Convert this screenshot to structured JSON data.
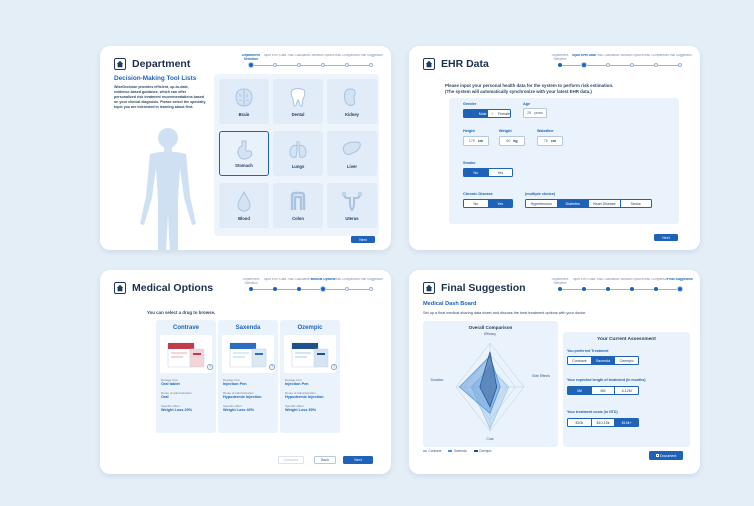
{
  "department": {
    "title": "Department",
    "subtitle": "Decision-Making Tool Lists",
    "description": "WiseDecision provides efficient, up-to-date, evidence-based guidance, which can offer personalized risk treatment recommendations based on your clinical diagnosis. Please select the specialty topic you are interested in learning about first.",
    "organs": [
      {
        "label": "Brain",
        "icon": "brain-icon"
      },
      {
        "label": "Dental",
        "icon": "tooth-icon"
      },
      {
        "label": "Kidney",
        "icon": "kidney-icon"
      },
      {
        "label": "Stomach",
        "icon": "stomach-icon"
      },
      {
        "label": "Lungs",
        "icon": "lungs-icon"
      },
      {
        "label": "Liver",
        "icon": "liver-icon"
      },
      {
        "label": "Blood",
        "icon": "blood-drop-icon"
      },
      {
        "label": "Colon",
        "icon": "colon-icon"
      },
      {
        "label": "Uterus",
        "icon": "uterus-icon"
      }
    ],
    "selected_organ": "Stomach",
    "next_label": "Next",
    "active_step": 0
  },
  "steps": [
    {
      "label": "Department Selection"
    },
    {
      "label": "Input EHR Data"
    },
    {
      "label": "Risk Calculation"
    },
    {
      "label": "Medical Options"
    },
    {
      "label": "Risk Comparison"
    },
    {
      "label": "Final Suggestion"
    }
  ],
  "ehr": {
    "title": "EHR Data",
    "intro_line1": "Please input your personal health data for the system to perform risk estimation.",
    "intro_line2": "(The system will automatically synchronize with your latest EHR data.)",
    "gender_label": "Gender",
    "male_label": "Male",
    "female_label": "Female",
    "age_label": "Age",
    "age_value": "25",
    "age_unit": "years",
    "height_label": "Height",
    "height_value": "170",
    "height_unit": "cm",
    "weight_label": "Weight",
    "weight_value": "60",
    "weight_unit": "kg",
    "waistline_label": "Waistline",
    "waistline_value": "70",
    "waistline_unit": "cm",
    "smoke_label": "Smoke",
    "no_label": "No",
    "yes_label": "Yes",
    "chronic_label": "Chronic Disease",
    "multi_label": "(multiple choice)",
    "diseases": [
      "Hypertension",
      "Diabetes",
      "Heart Disease",
      "Stroke"
    ],
    "next_label": "Next",
    "active_step": 1
  },
  "medical": {
    "title": "Medical Options",
    "hint": "You can select a drug to browse.",
    "dosage_key": "Dosage form",
    "route_key": "Route of administration",
    "effect_key": "Specific effect",
    "drugs": [
      {
        "name": "Contrave",
        "dosage": "Oral tablet",
        "route": "Oral",
        "effect": "Weight Loss 20%"
      },
      {
        "name": "Saxenda",
        "dosage": "Injection Pen",
        "route": "Hypodermic Injection",
        "effect": "Weight Loss 40%"
      },
      {
        "name": "Ozempic",
        "dosage": "Injection Pen",
        "route": "Hypodermic Injection",
        "effect": "Weight Loss 50%"
      }
    ],
    "compare_label": "Compare",
    "back_label": "Back",
    "next_label": "Next",
    "active_step": 3
  },
  "final": {
    "title": "Final Suggestion",
    "subtitle": "Medical Dash Board",
    "intro": "Set up a final medical sharing data sheet and discuss the best treatment options with your doctor.",
    "radar_title": "Overall Comparison",
    "axes": [
      "Efficacy",
      "Side Effects",
      "Cost",
      "Duration"
    ],
    "legend": [
      {
        "name": "Contrave",
        "color": "#9ec3ea"
      },
      {
        "name": "Saxenda",
        "color": "#4d8fd6"
      },
      {
        "name": "Ozempic",
        "color": "#1e4f8f"
      }
    ],
    "assessment_title": "Your Current Assessment",
    "preferred_label": "You preferred Treatment",
    "treatments": [
      "Contrave",
      "Saxenda",
      "Ozempic"
    ],
    "length_label": "Your expected length of treatment (in months)",
    "lengths": [
      "3M",
      "6M",
      "6-12M"
    ],
    "cost_label": "Your treatment costs (in NTD)",
    "costs": [
      "$10k",
      "$10-15k",
      "$15k+"
    ],
    "document_label": "Document",
    "active_step": 5
  },
  "chart_data": {
    "type": "radar",
    "title": "Overall Comparison",
    "categories": [
      "Efficacy",
      "Side Effects",
      "Cost",
      "Duration"
    ],
    "series": [
      {
        "name": "Contrave",
        "values": [
          0.45,
          0.55,
          0.95,
          0.55
        ]
      },
      {
        "name": "Saxenda",
        "values": [
          0.7,
          0.3,
          0.6,
          0.9
        ]
      },
      {
        "name": "Ozempic",
        "values": [
          0.8,
          0.2,
          0.45,
          0.3
        ]
      }
    ],
    "range": [
      0,
      1
    ],
    "legend_position": "bottom-left"
  }
}
